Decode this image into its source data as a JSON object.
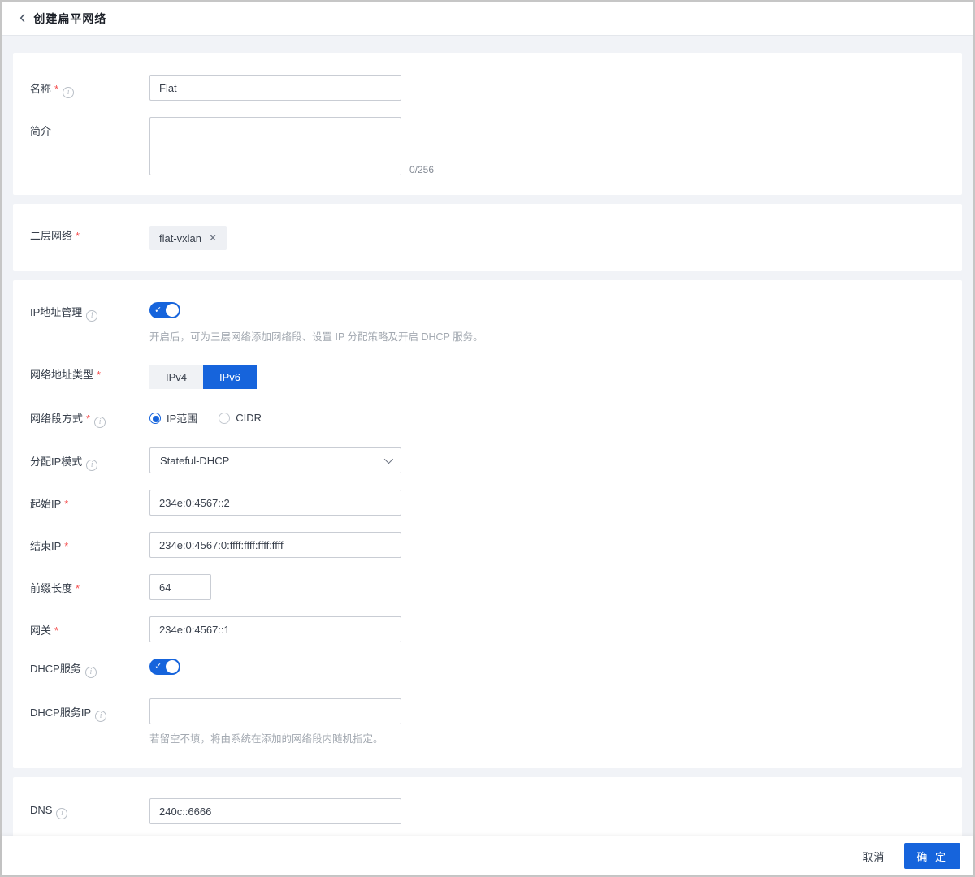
{
  "header": {
    "title": "创建扁平网络"
  },
  "icons": {
    "back": "‹",
    "info": "i",
    "check": "✓",
    "close": "✕"
  },
  "marks": {
    "required": "*"
  },
  "basic": {
    "name_label": "名称",
    "name_value": "Flat",
    "desc_label": "简介",
    "desc_counter": "0/256"
  },
  "l2": {
    "label": "二层网络",
    "tag": "flat-vxlan"
  },
  "ipm": {
    "label": "IP地址管理",
    "helper": "开启后，可为三层网络添加网络段、设置 IP 分配策略及开启 DHCP 服务。",
    "addr_type_label": "网络地址类型",
    "ipv4": "IPv4",
    "ipv6": "IPv6",
    "segment_label": "网络段方式",
    "ip_range": "IP范围",
    "cidr": "CIDR",
    "alloc_label": "分配IP模式",
    "alloc_value": "Stateful-DHCP",
    "start_ip_label": "起始IP",
    "start_ip_value": "234e:0:4567::2",
    "end_ip_label": "结束IP",
    "end_ip_value": "234e:0:4567:0:ffff:ffff:ffff:ffff",
    "prefix_label": "前缀长度",
    "prefix_value": "64",
    "gateway_label": "网关",
    "gateway_value": "234e:0:4567::1",
    "dhcp_label": "DHCP服务",
    "dhcp_ip_label": "DHCP服务IP",
    "dhcp_ip_helper": "若留空不填，将由系统在添加的网络段内随机指定。"
  },
  "dns": {
    "label": "DNS",
    "value": "240c::6666"
  },
  "footer": {
    "cancel": "取消",
    "confirm": "确 定"
  },
  "colors": {
    "primary": "#1664dc",
    "required": "#f54e4e",
    "page_bg": "#f1f3f7"
  }
}
